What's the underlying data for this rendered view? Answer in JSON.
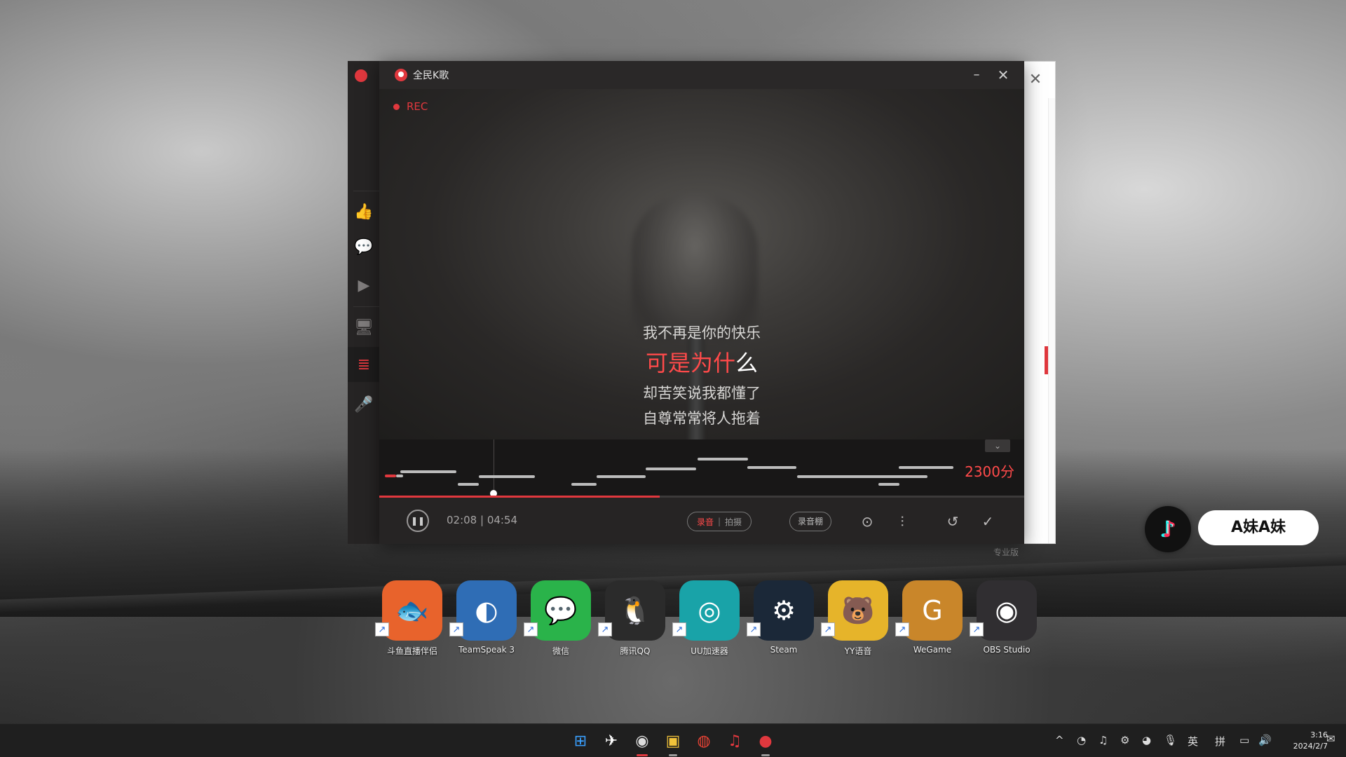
{
  "back_window": {
    "close_label": "✕",
    "footer_label": "专业版"
  },
  "sidebar": {
    "items": [
      {
        "icon": "thumb-up-icon",
        "glyph": "👍"
      },
      {
        "icon": "chat-icon",
        "glyph": "💬"
      },
      {
        "icon": "video-icon",
        "glyph": "▶"
      },
      {
        "icon": "monitor-icon",
        "glyph": "🖥"
      },
      {
        "icon": "song-list-icon",
        "glyph": "≣",
        "active": true
      },
      {
        "icon": "singer-icon",
        "glyph": "🎤"
      }
    ]
  },
  "window": {
    "title": "全民K歌",
    "minimize": "–",
    "close": "✕"
  },
  "video": {
    "rec_label": "REC"
  },
  "lyrics": {
    "prev": "我不再是你的快乐",
    "current_sung": "可是为什",
    "current_rest": "么",
    "next1": "却苦笑说我都懂了",
    "next2": "自尊常常将人拖着"
  },
  "pitch": {
    "score": "2300分",
    "collapse": "⌄"
  },
  "playback": {
    "progress": 0.435,
    "time": "02:08 | 04:54",
    "pause_glyph": "❚❚",
    "mode_active": "录音",
    "mode_inactive": "拍摄",
    "studio_label": "录音棚"
  },
  "control_icons": {
    "camera": "⊙",
    "mixer": "⫶",
    "replay": "↺",
    "done": "✓"
  },
  "tiktok": {
    "name": "A妹A妹"
  },
  "desktop_icons": [
    {
      "label": "斗鱼直播伴侣",
      "color": "#e8632c",
      "glyph": "🐟"
    },
    {
      "label": "TeamSpeak 3",
      "color": "#2f6db5",
      "glyph": "◐"
    },
    {
      "label": "微信",
      "color": "#2ab34a",
      "glyph": "💬"
    },
    {
      "label": "腾讯QQ",
      "color": "#2b2b2b",
      "glyph": "🐧"
    },
    {
      "label": "UU加速器",
      "color": "#19a3a8",
      "glyph": "◎"
    },
    {
      "label": "Steam",
      "color": "#1b2838",
      "glyph": "⚙"
    },
    {
      "label": "YY语音",
      "color": "#e6b42a",
      "glyph": "🐻"
    },
    {
      "label": "WeGame",
      "color": "#c9862a",
      "glyph": "G"
    },
    {
      "label": "OBS Studio",
      "color": "#302e31",
      "glyph": "◉"
    }
  ],
  "taskbar": {
    "apps": [
      {
        "name": "start-icon",
        "glyph": "⊞",
        "color": "#3aa0ff"
      },
      {
        "name": "game-icon",
        "glyph": "✈",
        "color": "#ffffff"
      },
      {
        "name": "obs-icon",
        "glyph": "◉",
        "color": "#dddddd",
        "active": true,
        "red": true
      },
      {
        "name": "file-manager-icon",
        "glyph": "▣",
        "color": "#f0c23a",
        "active": true
      },
      {
        "name": "chrome-icon",
        "glyph": "◍",
        "color": "#ea4335"
      },
      {
        "name": "netease-music-icon",
        "glyph": "♫",
        "color": "#e0383e"
      },
      {
        "name": "ksong-icon",
        "glyph": "●",
        "color": "#e0383e",
        "active": true
      }
    ],
    "tray": [
      {
        "name": "chevron-up-icon",
        "glyph": "^"
      },
      {
        "name": "wechat-tray-icon",
        "glyph": "◔"
      },
      {
        "name": "netease-tray-icon",
        "glyph": "♫"
      },
      {
        "name": "steam-tray-icon",
        "glyph": "⚙"
      },
      {
        "name": "yy-tray-icon",
        "glyph": "◕"
      },
      {
        "name": "mic-icon",
        "glyph": "🎙"
      },
      {
        "name": "ime-lang",
        "glyph": "英"
      },
      {
        "name": "ime-mode",
        "glyph": "拼"
      },
      {
        "name": "network-icon",
        "glyph": "▭"
      },
      {
        "name": "volume-icon",
        "glyph": "🔊"
      }
    ],
    "time": "3:16",
    "date": "2024/2/7",
    "notification_glyph": "✉"
  }
}
